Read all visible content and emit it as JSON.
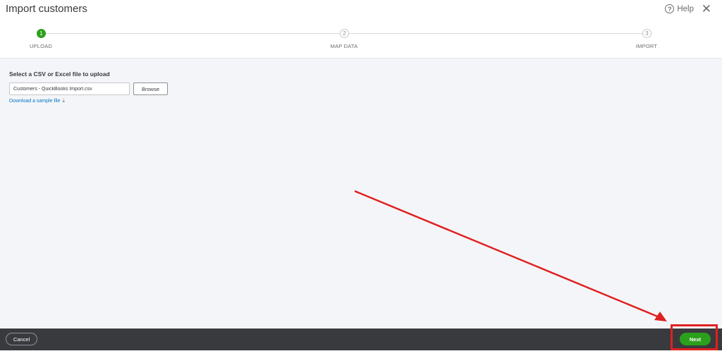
{
  "dialog": {
    "title": "Import customers",
    "help_label": "Help",
    "help_icon": "question-circle-icon",
    "close_icon": "close-icon"
  },
  "stepper": {
    "steps": [
      {
        "number": "1",
        "label": "UPLOAD",
        "state": "active"
      },
      {
        "number": "2",
        "label": "MAP DATA",
        "state": "inactive"
      },
      {
        "number": "3",
        "label": "IMPORT",
        "state": "inactive"
      }
    ]
  },
  "upload": {
    "heading": "Select a CSV or Excel file to upload",
    "file_value": "Customers - QuickBooks Import.csv",
    "browse_label": "Browse",
    "sample_link": "Download a sample file",
    "download_icon": "download-icon"
  },
  "footer": {
    "cancel_label": "Cancel",
    "next_label": "Next"
  },
  "annotation": {
    "arrow_color": "#e02020",
    "box_color": "#e02020"
  },
  "colors": {
    "accent_green": "#2ca01c",
    "link_blue": "#0077c5",
    "footer_bg": "#393a3d"
  }
}
